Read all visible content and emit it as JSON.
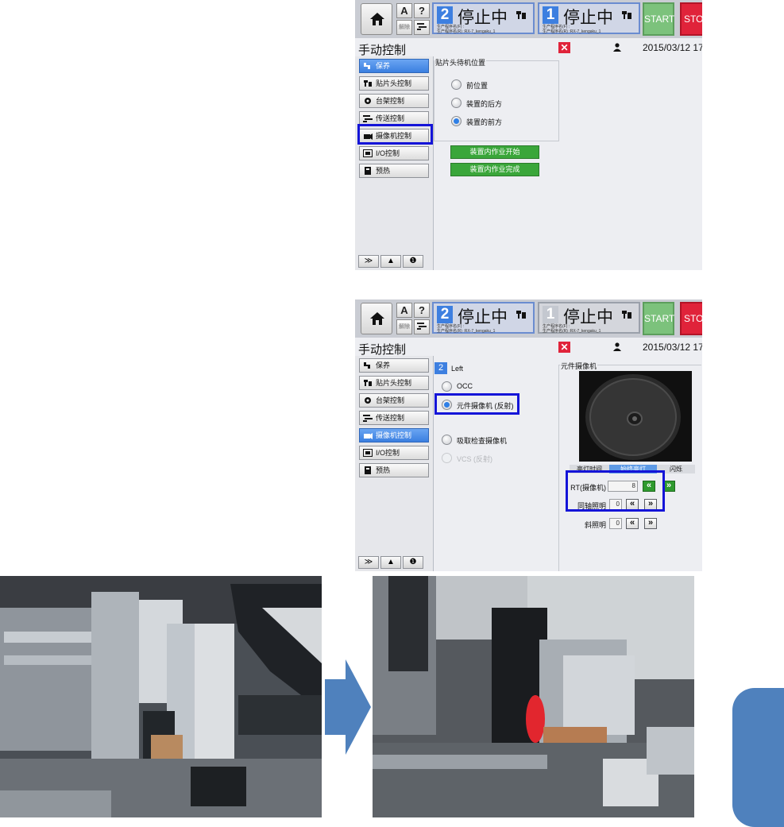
{
  "top_screen": {
    "topbar": {
      "lane2": {
        "number": "2",
        "status": "停止中",
        "program_line1": "生产程序名(F) :",
        "program_line2": "生产程序名(R) :RX-7_kengaku_1"
      },
      "lane1": {
        "number": "1",
        "status": "停止中",
        "program_line1": "生产程序名(F) :",
        "program_line2": "生产程序名(R) :RX-7_kengaku_1"
      },
      "start_label": "START",
      "stop_label": "STO",
      "help_label": "?",
      "small_btn_a": "A",
      "small_btn_disabled": "解除"
    },
    "title": "手动控制",
    "close_label": "✕",
    "datetime": "2015/03/12 17:0",
    "sidebar": [
      "保养",
      "贴片头控制",
      "台架控制",
      "传送控制",
      "摄像机控制",
      "I/O控制",
      "预热"
    ],
    "group_title": "贴片头待机位置",
    "options": [
      "前位置",
      "装置的后方",
      "装置的前方"
    ],
    "buttons": [
      "装置内作业开始",
      "装置内作业完成"
    ]
  },
  "bottom_screen": {
    "topbar": {
      "lane2": {
        "number": "2",
        "status": "停止中",
        "program_line1": "生产程序名(F) :",
        "program_line2": "生产程序名(R) :RX-7_kengaku_1"
      },
      "lane1": {
        "number": "1",
        "status": "停止中",
        "program_line1": "生产程序名(F) :",
        "program_line2": "生产程序名(R) :RX-7_kengaku_1"
      },
      "start_label": "START",
      "stop_label": "STO",
      "help_label": "?",
      "small_btn_a": "A",
      "small_btn_disabled": "解除"
    },
    "title": "手动控制",
    "close_label": "✕",
    "datetime": "2015/03/12 17:0",
    "sidebar": [
      "保养",
      "贴片头控制",
      "台架控制",
      "传送控制",
      "摄像机控制",
      "I/O控制",
      "预热"
    ],
    "lane_badge": "2",
    "lane_name": "Left",
    "options": [
      "OCC",
      "元件摄像机 (反射)",
      "吸取检查摄像机",
      "VCS (反射)"
    ],
    "camera_group_title": "元件摄像机",
    "camera_tabs": [
      "亮灯时间",
      "始终亮灯",
      "闪烁"
    ],
    "params": [
      {
        "label": "RT(摄像机)",
        "value": "8"
      },
      {
        "label": "同轴照明",
        "value": "0"
      },
      {
        "label": "斜照明",
        "value": "0"
      }
    ],
    "arrow_left": "«",
    "arrow_right": "»"
  },
  "bottom_buttons": [
    "≫",
    "▲",
    "❶"
  ],
  "colors": {
    "accent_blue": "#3d7fe0",
    "highlight": "#1414d8",
    "start_green": "#7cc27c",
    "stop_red": "#e0233a",
    "action_green": "#3aa63a",
    "side_tab": "#4f81bd"
  }
}
